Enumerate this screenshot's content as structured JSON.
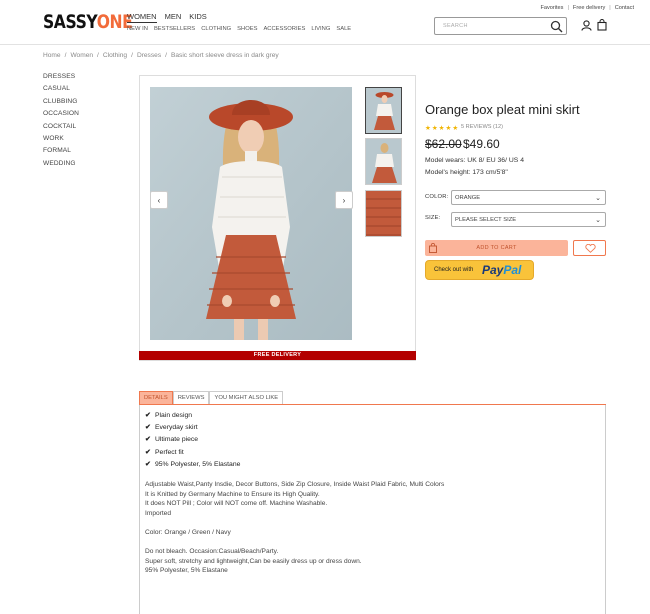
{
  "brand": {
    "part1": "SASSY",
    "part2": "ONE"
  },
  "main_nav": [
    "WOMEN",
    "MEN",
    "KIDS"
  ],
  "sub_nav": [
    "NEW IN",
    "BESTSELLERS",
    "CLOTHING",
    "SHOES",
    "ACCESSORIES",
    "LIVING",
    "SALE"
  ],
  "top_links": [
    "Favorites",
    "Free delivery",
    "Contact"
  ],
  "search": {
    "placeholder": "SEARCH"
  },
  "breadcrumb": [
    "Home",
    "Women",
    "Clothing",
    "Dresses",
    "Basic short sleeve dress in dark grey"
  ],
  "side_nav": [
    "DRESSES",
    "CASUAL",
    "CLUBBING",
    "OCCASION",
    "COCKTAIL",
    "WORK",
    "FORMAL",
    "WEDDING"
  ],
  "gallery": {
    "prev": "‹",
    "next": "›",
    "free_delivery": "FREE DELIVERY"
  },
  "product": {
    "title": "Orange box pleat mini skirt",
    "rating_stars": 5,
    "reviews": "5 REVIEWS (12)",
    "old_price": "$62.00",
    "new_price": "$49.60",
    "model_wears": "Model wears: UK 8/ EU 36/ US 4",
    "model_height": "Model's height: 173 cm/5'8\""
  },
  "options": {
    "color_label": "COLOR:",
    "color_value": "ORANGE",
    "size_label": "SIZE:",
    "size_value": "PLEASE SELECT SIZE"
  },
  "actions": {
    "add_to_cart": "ADD TO CART",
    "paypal_prefix": "Check out with",
    "paypal_a": "Pay",
    "paypal_b": "Pal"
  },
  "tabs": [
    "DETAILS",
    "REVIEWS",
    "YOU MIGHT ALSO LIKE"
  ],
  "features": [
    "Plain design",
    "Everyday skirt",
    "Ultimate piece",
    "Perfect fit",
    "95% Polyester, 5% Elastane"
  ],
  "description": [
    "Adjustable Waist,Panty Insdie, Decor Buttons, Side Zip Closure, Inside Waist Plaid Fabric, Multi Colors",
    "It is Knitted by Germany Machine to Ensure its High Quality.",
    "It does NOT Pill ; Color will NOT come off. Machine Washable.",
    "Imported",
    "",
    "Color: Orange / Green / Navy",
    "",
    "Do not bleach. Occasion:Casual/Beach/Party.",
    "Super soft, stretchy and lightweight,Can be easily dress up or dress down.",
    "95% Polyester, 5% Elastane"
  ],
  "colors": {
    "accent": "#f26b3a",
    "accent_light": "#fbb49a",
    "free_bar": "#b30000",
    "star": "#f0b400",
    "paypal_yellow": "#f9c33a"
  }
}
